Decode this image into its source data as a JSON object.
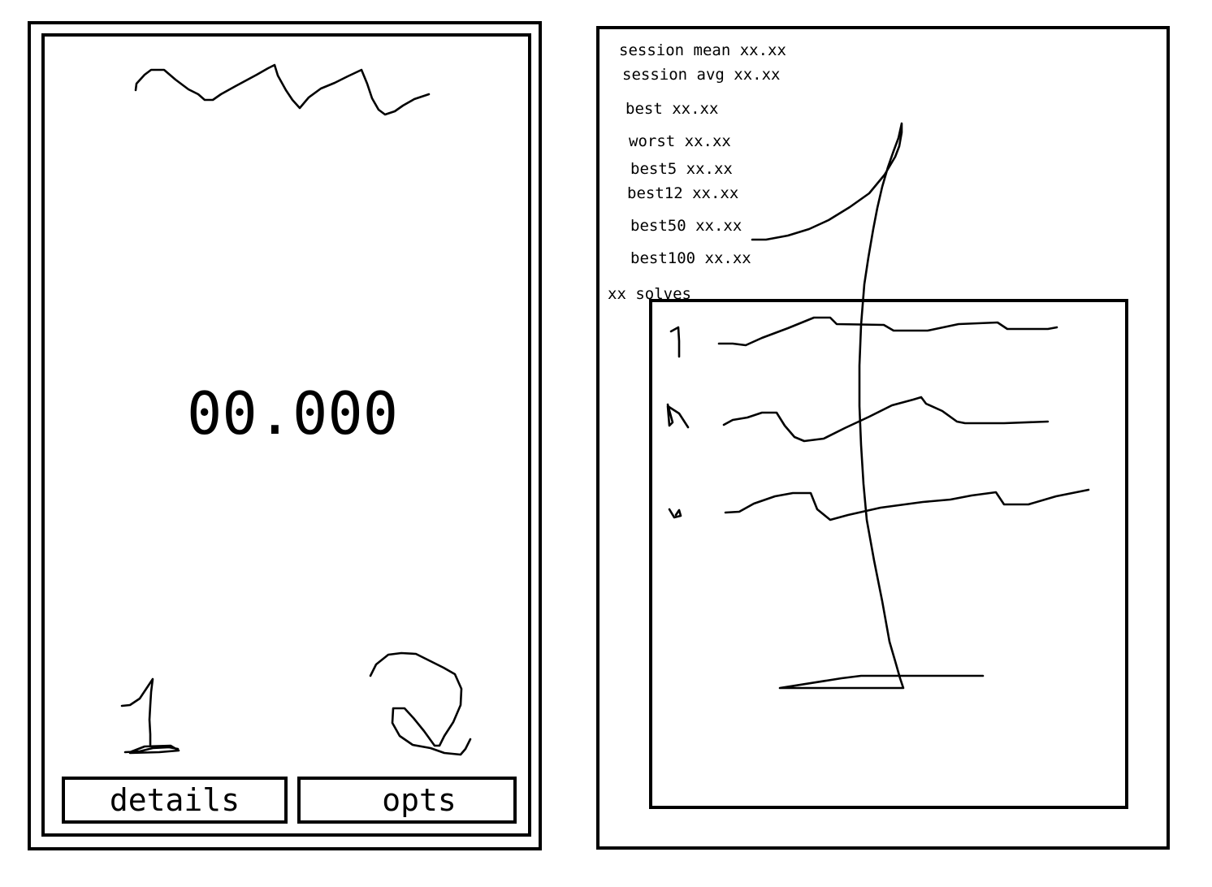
{
  "left_panel": {
    "timer": "00.000",
    "buttons": {
      "details": "details",
      "opts": "opts"
    }
  },
  "right_panel": {
    "stats": {
      "session_mean": "session mean xx.xx",
      "session_avg": "session avg xx.xx",
      "best": "best xx.xx",
      "worst": "worst xx.xx",
      "best5": "best5 xx.xx",
      "best12": "best12 xx.xx",
      "best50": "best50 xx.xx",
      "best100": "best100 xx.xx",
      "solves": "xx solves"
    }
  }
}
